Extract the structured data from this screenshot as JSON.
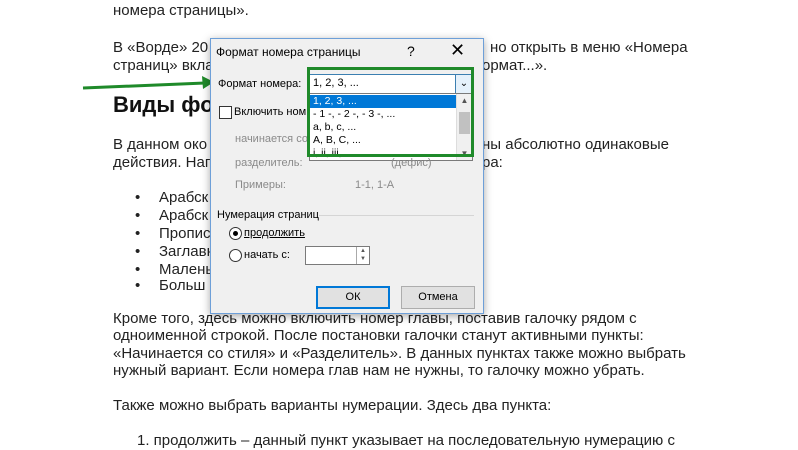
{
  "document": {
    "line1": "номера страницы».",
    "line2a": "В «Ворде» 20",
    "line2b": "но открыть в меню «Номера",
    "line3a": "страниц» вкла",
    "line3b": "ормат...».",
    "heading": "Виды фо",
    "para1a": "В данном око",
    "para1b": "ны абсолютно одинаковые",
    "para2a": "действия. Наг",
    "para2b": "ра:",
    "bullets": [
      "Арабск",
      "Арабск",
      "Пропис",
      "Заглавн",
      "Малень",
      "Больш"
    ],
    "para3": "Кроме того, здесь можно включить номер главы, поставив галочку рядом с",
    "para4": "одноименной строкой. После постановки галочки станут активными пункты:",
    "para5": "«Начинается со стиля» и «Разделитель». В данных пунктах также можно выбрать",
    "para6": "нужный вариант. Если номера глав нам не нужны, то галочку можно убрать.",
    "para7": "Также можно выбрать варианты нумерации. Здесь два пункта:",
    "para8": "1.  продолжить – данный пункт указывает  на последовательную нумерацию с"
  },
  "dialog": {
    "title": "Формат номера страницы",
    "help_label": "?",
    "close_label": "✕",
    "format_label": "Формат номера:",
    "format_value": "1, 2, 3, ...",
    "format_options": [
      "1, 2, 3, ...",
      "- 1 -, - 2 -, - 3 -, ...",
      "a, b, c, ...",
      "A, B, C, ...",
      "i, ii, iii, ..."
    ],
    "include_chapter_label": "Включить ном",
    "starts_with_label": "начинается со",
    "separator_label": "разделитель:",
    "separator_value": "(дефис)",
    "examples_label": "Примеры:",
    "examples_value": "1-1, 1-A",
    "numbering_group": "Нумерация страниц",
    "continue_label": "продолжить",
    "start_at_label": "начать с:",
    "ok_label": "ОК",
    "cancel_label": "Отмена"
  },
  "colors": {
    "highlight_green": "#1f8a2a",
    "selection_blue": "#0078d7"
  }
}
